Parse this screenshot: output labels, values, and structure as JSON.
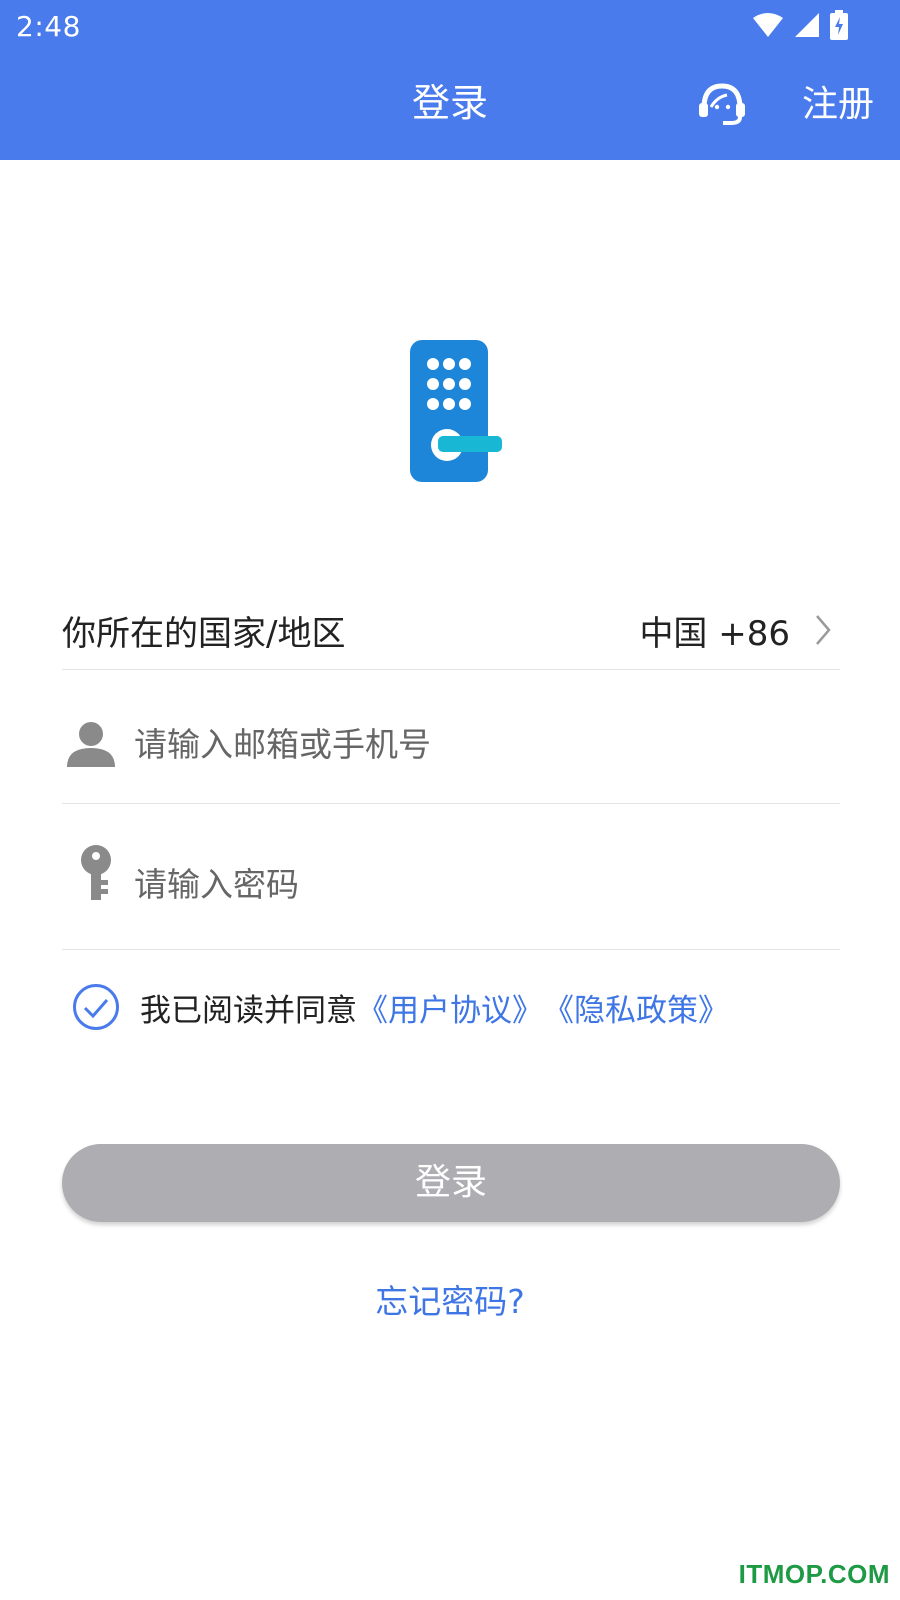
{
  "status_bar": {
    "time": "2:48"
  },
  "header": {
    "title": "登录",
    "support_icon": "headset-icon",
    "register_label": "注册"
  },
  "colors": {
    "primary": "#4a7bec",
    "link": "#3f76e6",
    "button_disabled": "#aeaeb2",
    "logo_blue": "#1d86d8",
    "logo_accent": "#18b8d4"
  },
  "form": {
    "region_label": "你所在的国家/地区",
    "region_value": "中国 +86",
    "account_placeholder": "请输入邮箱或手机号",
    "password_placeholder": "请输入密码"
  },
  "agreement": {
    "checked": true,
    "text": "我已阅读并同意",
    "user_agreement": "《用户协议》",
    "privacy_policy": "《隐私政策》"
  },
  "actions": {
    "login_label": "登录",
    "forgot_label": "忘记密码?"
  },
  "watermark": "ITMOP.COM"
}
